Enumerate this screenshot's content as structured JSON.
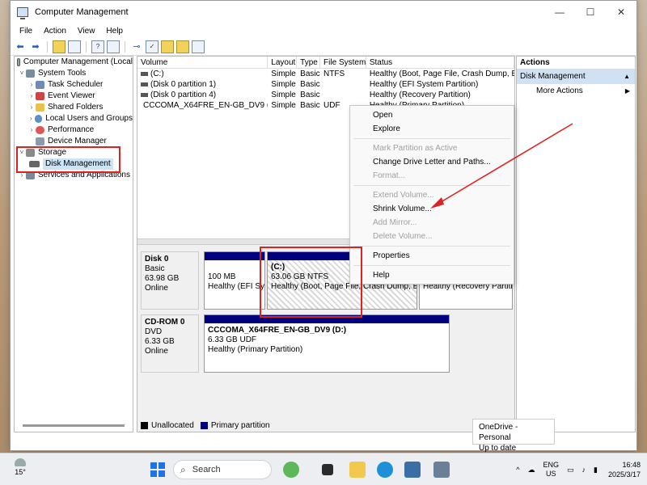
{
  "window": {
    "title": "Computer Management",
    "minimize": "—",
    "maximize": "☐",
    "close": "✕"
  },
  "menu": [
    "File",
    "Action",
    "View",
    "Help"
  ],
  "tree": {
    "root": "Computer Management (Local",
    "system_tools": "System Tools",
    "items": [
      "Task Scheduler",
      "Event Viewer",
      "Shared Folders",
      "Local Users and Groups",
      "Performance",
      "Device Manager"
    ],
    "storage": "Storage",
    "disk_management": "Disk Management",
    "services": "Services and Applications"
  },
  "volume_table": {
    "headers": [
      "Volume",
      "Layout",
      "Type",
      "File System",
      "Status"
    ],
    "rows": [
      [
        "(C:)",
        "Simple",
        "Basic",
        "NTFS",
        "Healthy (Boot, Page File, Crash Dump, Bas"
      ],
      [
        "(Disk 0 partition 1)",
        "Simple",
        "Basic",
        "",
        "Healthy (EFI System Partition)"
      ],
      [
        "(Disk 0 partition 4)",
        "Simple",
        "Basic",
        "",
        "Healthy (Recovery Partition)"
      ],
      [
        "CCCOMA_X64FRE_EN-GB_DV9 (D:)",
        "Simple",
        "Basic",
        "UDF",
        "Healthy (Primary Partition)"
      ]
    ]
  },
  "disks": {
    "disk0": {
      "name": "Disk 0",
      "type": "Basic",
      "size": "63.98 GB",
      "state": "Online"
    },
    "p_efi": {
      "size": "100 MB",
      "status": "Healthy (EFI Sys"
    },
    "p_c": {
      "name": "(C:)",
      "size": "63.06 GB NTFS",
      "status": "Healthy (Boot, Page File, Crash Dump, Basi"
    },
    "p_rec": {
      "status": "Healthy (Recovery Partitio"
    },
    "cdrom": {
      "name": "CD-ROM 0",
      "type": "DVD",
      "size": "6.33 GB",
      "state": "Online"
    },
    "p_d": {
      "name": "CCCOMA_X64FRE_EN-GB_DV9  (D:)",
      "size": "6.33 GB UDF",
      "status": "Healthy (Primary Partition)"
    }
  },
  "legend": {
    "unallocated": "Unallocated",
    "primary": "Primary partition"
  },
  "actions": {
    "header": "Actions",
    "section": "Disk Management",
    "more": "More Actions",
    "up_arrow": "▲",
    "right_arrow": "▶"
  },
  "context_menu": {
    "open": "Open",
    "explore": "Explore",
    "mark_active": "Mark Partition as Active",
    "change_letter": "Change Drive Letter and Paths...",
    "format": "Format...",
    "extend": "Extend Volume...",
    "shrink": "Shrink Volume...",
    "add_mirror": "Add Mirror...",
    "delete": "Delete Volume...",
    "properties": "Properties",
    "help": "Help"
  },
  "tooltip": {
    "line1": "OneDrive - Personal",
    "line2": "Up to date"
  },
  "taskbar": {
    "temp": "15°",
    "search": "Search",
    "lang1": "ENG",
    "lang2": "US",
    "time": "16:48",
    "date": "2025/3/17"
  },
  "colors": {
    "primary_partition": "#00007e",
    "annotation": "#dd2222",
    "selection": "#cce4f7"
  }
}
